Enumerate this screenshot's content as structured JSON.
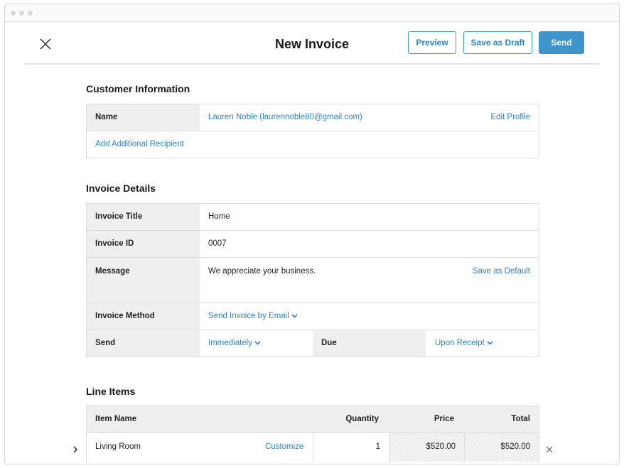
{
  "header": {
    "title": "New Invoice",
    "preview_label": "Preview",
    "draft_label": "Save as Draft",
    "send_label": "Send"
  },
  "customer": {
    "section_title": "Customer Information",
    "name_label": "Name",
    "name_value": "Lauren Noble (laurennoble80@gmail.com)",
    "edit_profile": "Edit Profile",
    "add_recipient": "Add Additional Recipient"
  },
  "details": {
    "section_title": "Invoice Details",
    "title_label": "Invoice Title",
    "title_value": "Home",
    "id_label": "Invoice ID",
    "id_value": "0007",
    "message_label": "Message",
    "message_value": "We appreciate your business.",
    "save_default": "Save as Default",
    "method_label": "Invoice Method",
    "method_value": "Send Invoice by Email",
    "send_label": "Send",
    "send_value": "Immediately",
    "due_label": "Due",
    "due_value": "Upon Receipt"
  },
  "line_items": {
    "section_title": "Line Items",
    "columns": {
      "item_name": "Item Name",
      "quantity": "Quantity",
      "price": "Price",
      "total": "Total"
    },
    "rows": [
      {
        "name": "Living Room",
        "customize": "Customize",
        "quantity": "1",
        "price": "$520.00",
        "total": "$520.00"
      }
    ]
  },
  "colors": {
    "accent": "#3d95c9",
    "link": "#2a86bd",
    "label_bg": "#efefef"
  }
}
